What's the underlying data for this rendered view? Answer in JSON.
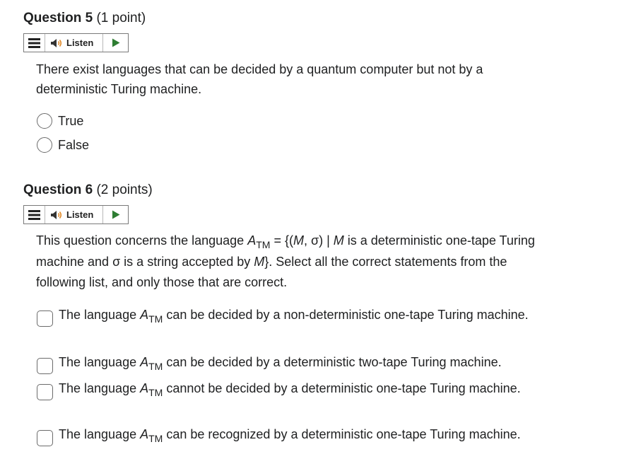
{
  "questions": [
    {
      "title": "Question 5",
      "points": "(1 point)",
      "listen_label": "Listen",
      "text": "There exist languages that can be decided by a quantum computer but not by a deterministic Turing machine.",
      "options": [
        "True",
        "False"
      ]
    },
    {
      "title": "Question 6",
      "points": "(2 points)",
      "listen_label": "Listen",
      "text_parts": {
        "p1": "This question concerns the language ",
        "lang_A": "A",
        "lang_sub": "TM",
        "p2": " = {(",
        "var_M": "M",
        "p3": ", σ) | ",
        "var_M2": "M",
        "p4": " is a deterministic one-tape Turing machine and σ is a string accepted by ",
        "var_M3": "M",
        "p5": "}.  Select all the correct statements from the following list, and only those that are correct."
      },
      "options": [
        {
          "pre": "The language ",
          "A": "A",
          "sub": "TM",
          "post": " can be decided by a non-deterministic one-tape Turing machine."
        },
        {
          "pre": "The language ",
          "A": "A",
          "sub": "TM",
          "post": " can be decided by a deterministic two-tape Turing machine."
        },
        {
          "pre": "The language ",
          "A": "A",
          "sub": "TM",
          "post": " cannot be decided by a deterministic one-tape Turing machine."
        },
        {
          "pre": "The language ",
          "A": "A",
          "sub": "TM",
          "post": " can be recognized by a deterministic one-tape Turing machine."
        }
      ]
    }
  ],
  "icons": {
    "menu": "menu-icon",
    "speaker": "speaker-icon",
    "play": "play-icon"
  },
  "colors": {
    "text": "#202122",
    "border": "#6b6b6b",
    "play": "#2e7d32"
  }
}
